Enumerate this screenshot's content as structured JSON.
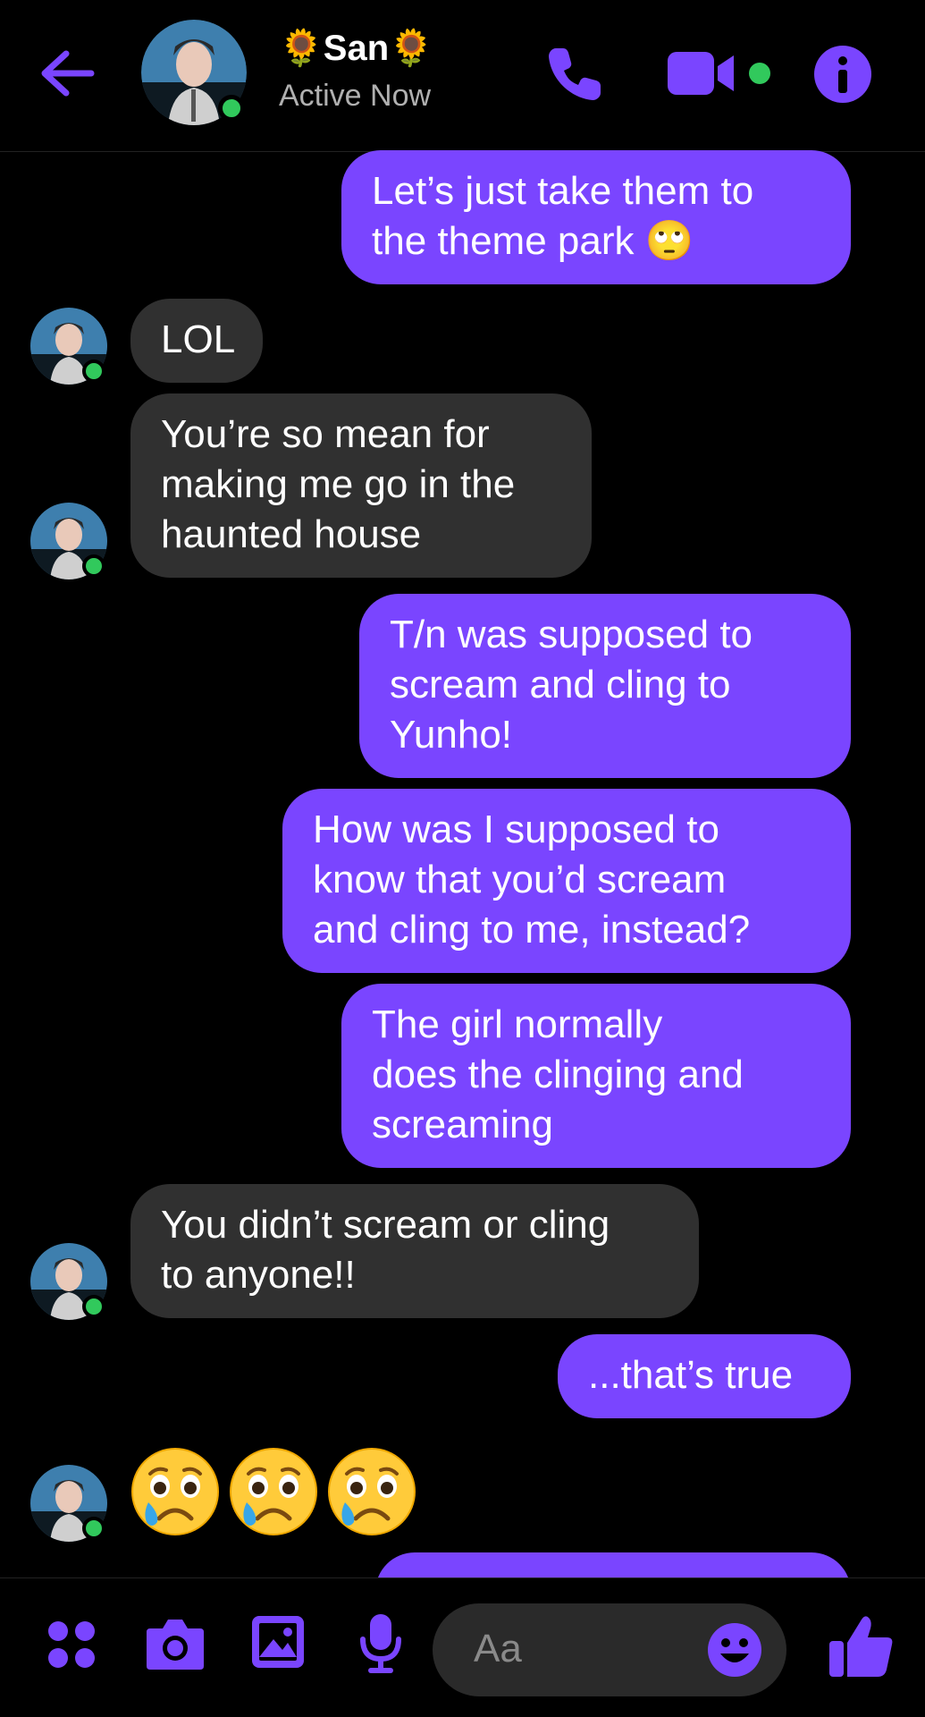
{
  "header": {
    "name": "🌻San🌻",
    "status": "Active Now"
  },
  "messages": [
    {
      "from": "me",
      "lines": [
        "Let’s just take them to",
        "the theme park 🙄"
      ]
    },
    {
      "from": "them",
      "lines": [
        "LOL"
      ]
    },
    {
      "from": "them",
      "lines": [
        "You’re so mean for",
        "making me go in the",
        "haunted house"
      ]
    },
    {
      "from": "me",
      "lines": [
        "T/n was supposed to",
        "scream and cling to",
        "Yunho!"
      ]
    },
    {
      "from": "me",
      "lines": [
        "How was I supposed to",
        "know that you’d scream",
        "and cling to me, instead?"
      ]
    },
    {
      "from": "me",
      "lines": [
        "The girl normally",
        "does the clinging and",
        "screaming"
      ]
    },
    {
      "from": "them",
      "lines": [
        "You didn’t scream or cling",
        "to anyone!!"
      ]
    },
    {
      "from": "me",
      "lines": [
        "...that’s true"
      ]
    }
  ],
  "reaction_emojis": [
    "crying-face",
    "crying-face",
    "crying-face"
  ],
  "composer": {
    "placeholder": "Aa"
  },
  "colors": {
    "accent": "#7a45ff",
    "incoming_bubble": "#303030",
    "online": "#31c95c"
  }
}
